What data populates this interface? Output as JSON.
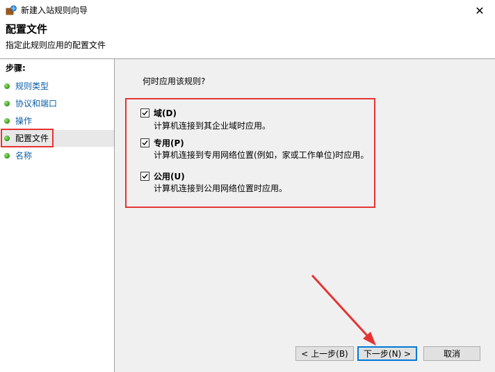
{
  "window": {
    "title": "新建入站规则向导",
    "close_glyph": "✕"
  },
  "header": {
    "title": "配置文件",
    "subtitle": "指定此规则应用的配置文件"
  },
  "steps": {
    "label": "步骤:",
    "items": [
      {
        "label": "规则类型"
      },
      {
        "label": "协议和端口"
      },
      {
        "label": "操作"
      },
      {
        "label": "配置文件",
        "current": true
      },
      {
        "label": "名称"
      }
    ]
  },
  "main": {
    "question": "何时应用该规则?",
    "options": [
      {
        "title": "域(D)",
        "desc": "计算机连接到其企业域时应用。",
        "checked": true
      },
      {
        "title": "专用(P)",
        "desc": "计算机连接到专用网络位置(例如，家或工作单位)时应用。",
        "checked": true
      },
      {
        "title": "公用(U)",
        "desc": "计算机连接到公用网络位置时应用。",
        "checked": true
      }
    ]
  },
  "buttons": {
    "back": "< 上一步(B)",
    "next": "下一步(N) >",
    "cancel": "取消"
  },
  "colors": {
    "annotation": "#e53333",
    "link": "#0b5fa5",
    "focus": "#0078d7"
  },
  "icons": {
    "app": "firewall-icon",
    "step_bullet": "green-dot-icon",
    "check": "checkmark-icon"
  }
}
